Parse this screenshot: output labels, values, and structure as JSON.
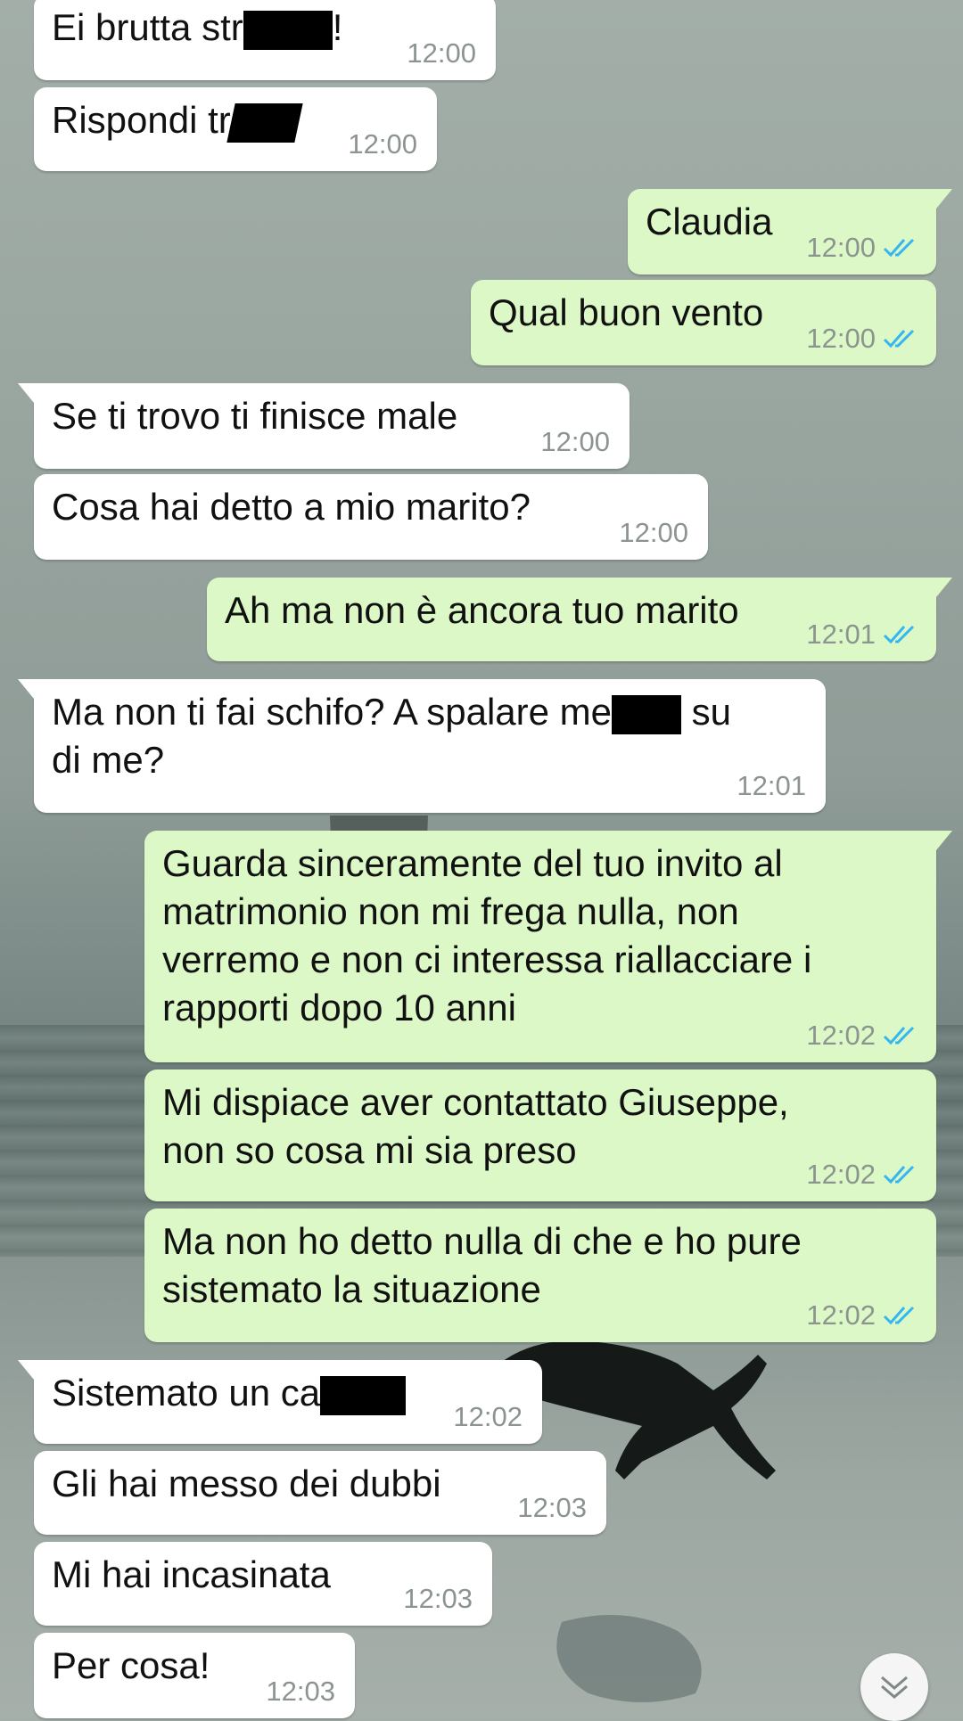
{
  "colors": {
    "incoming_bubble": "#ffffff",
    "outgoing_bubble": "#dcf8c6",
    "timestamp": "#8c948f",
    "read_ticks": "#34b7f1",
    "redaction": "#000000"
  },
  "messages": [
    {
      "dir": "in",
      "text_a": "Ei brutta str",
      "text_b": "!",
      "time": "12:00",
      "redacted": true
    },
    {
      "dir": "in",
      "text_a": "Rispondi tr",
      "time": "12:00",
      "redacted": true
    },
    {
      "dir": "out",
      "text": "Claudia",
      "time": "12:00",
      "status_icon": "double-check-read-icon"
    },
    {
      "dir": "out",
      "text": "Qual buon vento",
      "time": "12:00",
      "status_icon": "double-check-read-icon"
    },
    {
      "dir": "in",
      "text": "Se ti trovo ti finisce male",
      "time": "12:00"
    },
    {
      "dir": "in",
      "text": "Cosa hai detto a mio marito?",
      "time": "12:00"
    },
    {
      "dir": "out",
      "text": "Ah ma non è ancora tuo marito",
      "time": "12:01",
      "status_icon": "double-check-read-icon"
    },
    {
      "dir": "in",
      "text_a": "Ma non ti fai schifo? A spalare me",
      "text_b": " su",
      "text_c": "di me?",
      "time": "12:01",
      "redacted": true
    },
    {
      "dir": "out",
      "text": "Guarda sinceramente del tuo invito al\nmatrimonio non mi frega nulla, non\nverremo e non ci interessa riallacciare i\nrapporti dopo 10 anni",
      "time": "12:02",
      "status_icon": "double-check-read-icon"
    },
    {
      "dir": "out",
      "text": "Mi dispiace aver contattato Giuseppe,\nnon so cosa mi sia preso",
      "time": "12:02",
      "status_icon": "double-check-read-icon"
    },
    {
      "dir": "out",
      "text": "Ma non ho detto nulla di che e ho pure\nsistemato la situazione",
      "time": "12:02",
      "status_icon": "double-check-read-icon"
    },
    {
      "dir": "in",
      "text_a": "Sistemato un ca",
      "time": "12:02",
      "redacted": true
    },
    {
      "dir": "in",
      "text": "Gli hai messo dei dubbi",
      "time": "12:03"
    },
    {
      "dir": "in",
      "text": "Mi hai incasinata",
      "time": "12:03"
    },
    {
      "dir": "in",
      "text": "Per cosa!",
      "time": "12:03"
    }
  ],
  "scroll_button": {
    "icon": "double-chevron-down-icon"
  }
}
